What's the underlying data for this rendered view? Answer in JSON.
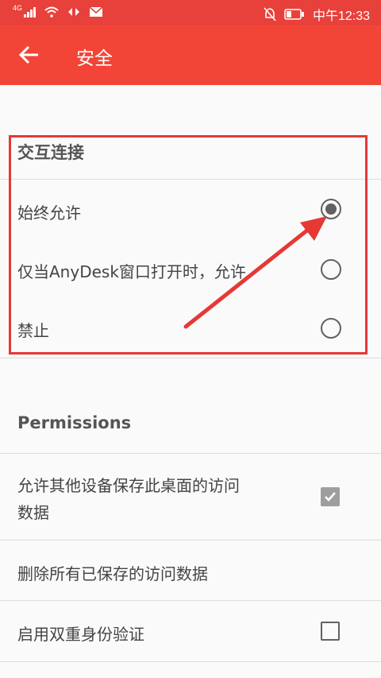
{
  "status_bar": {
    "network": "4G",
    "time": "中午12:33"
  },
  "app_bar": {
    "title": "安全"
  },
  "interaction": {
    "header": "交互连接",
    "options": [
      {
        "label": "始终允许",
        "selected": true
      },
      {
        "label": "仅当AnyDesk窗口打开时，允许",
        "selected": false
      },
      {
        "label": "禁止",
        "selected": false
      }
    ]
  },
  "permissions": {
    "header": "Permissions",
    "items": [
      {
        "label_line1": "允许其他设备保存此桌面的访问",
        "label_line2": "数据",
        "control": "checkbox",
        "checked": true
      },
      {
        "label": "删除所有已保存的访问数据",
        "control": "none"
      },
      {
        "label": "启用双重身份验证",
        "control": "checkbox",
        "checked": false
      }
    ]
  },
  "colors": {
    "accent": "#f24538",
    "annotation": "#e53935"
  }
}
